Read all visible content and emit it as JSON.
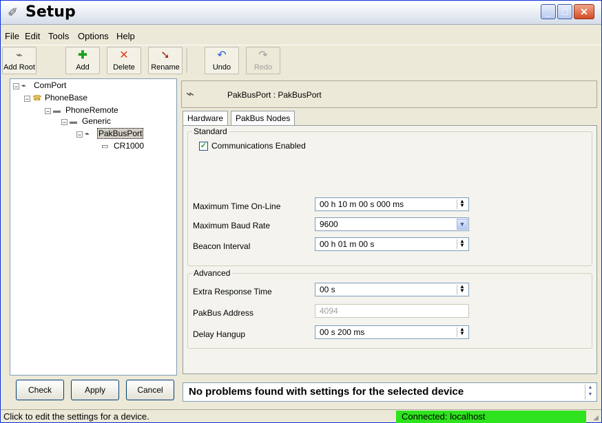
{
  "window": {
    "title": "Setup"
  },
  "menu": [
    {
      "label": "File",
      "u": "F"
    },
    {
      "label": "Edit",
      "u": "E"
    },
    {
      "label": "Tools",
      "u": "T"
    },
    {
      "label": "Options",
      "u": "O"
    },
    {
      "label": "Help",
      "u": "H"
    }
  ],
  "toolbar": {
    "add_root": "Add Root",
    "add": "Add",
    "delete": "Delete",
    "rename": "Rename",
    "undo": "Undo",
    "redo": "Redo"
  },
  "tree": {
    "nodes": [
      {
        "label": "ComPort",
        "icon": "port-icon"
      },
      {
        "label": "PhoneBase",
        "icon": "phone-icon"
      },
      {
        "label": "PhoneRemote",
        "icon": "modem-icon"
      },
      {
        "label": "Generic",
        "icon": "modem-icon"
      },
      {
        "label": "PakBusPort",
        "icon": "port-icon"
      },
      {
        "label": "CR1000",
        "icon": "datalogger-icon"
      }
    ]
  },
  "buttons": {
    "check": "Check",
    "apply": "Apply",
    "cancel": "Cancel"
  },
  "device_header": {
    "text": "PakBusPort : PakBusPort"
  },
  "tabs": [
    {
      "label": "Hardware",
      "active": true
    },
    {
      "label": "PakBus Nodes",
      "active": false
    }
  ],
  "standard": {
    "title": "Standard",
    "comms_enabled_label": "Communications Enabled",
    "comms_enabled": true,
    "max_time_label": "Maximum Time On-Line",
    "max_time_value": "00 h 10 m 00 s 000 ms",
    "max_baud_label": "Maximum Baud Rate",
    "max_baud_value": "9600",
    "beacon_label": "Beacon Interval",
    "beacon_value": "00 h 01 m 00 s"
  },
  "advanced": {
    "title": "Advanced",
    "extra_resp_label": "Extra Response Time",
    "extra_resp_value": "00 s",
    "pakbus_addr_label": "PakBus Address",
    "pakbus_addr_value": "4094",
    "delay_hangup_label": "Delay Hangup",
    "delay_hangup_value": "00 s 200 ms"
  },
  "message": "No problems found with settings for the selected device",
  "statusbar": {
    "left": "Click to edit the settings for a device.",
    "right": "Connected: localhost",
    "right_color": "#2ee21d"
  }
}
